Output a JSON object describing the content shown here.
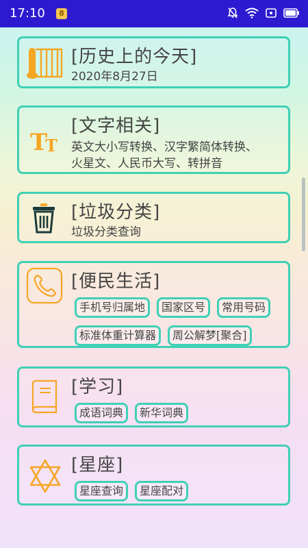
{
  "status_bar": {
    "time": "17:10",
    "notif_badge": "8"
  },
  "cards": {
    "history": {
      "title": "[历史上的今天]",
      "desc": "2020年8月27日"
    },
    "text": {
      "title": "[文字相关]",
      "desc_line1": "英文大小写转换、汉字繁简体转换、",
      "desc_line2": "火星文、人民币大写、转拼音"
    },
    "trash": {
      "title": "[垃圾分类]",
      "desc": "垃圾分类查询"
    },
    "life": {
      "title": "[便民生活]",
      "chips": [
        "手机号归属地",
        "国家区号",
        "常用号码",
        "标准体重计算器",
        "周公解梦[聚合]"
      ]
    },
    "study": {
      "title": "[学习]",
      "chips": [
        "成语词典",
        "新华词典"
      ]
    },
    "star": {
      "title": "[星座]",
      "chips": [
        "星座查询",
        "星座配对"
      ]
    }
  },
  "icons": {
    "history": "scroll-icon",
    "text": "text-tt-icon",
    "trash": "trash-can-icon",
    "life": "phone-icon",
    "study": "book-icon",
    "star": "star-of-david-icon"
  },
  "colors": {
    "accent": "#3fd0b5",
    "icon": "#f5a623",
    "status_bar": "#2d1ad0"
  }
}
